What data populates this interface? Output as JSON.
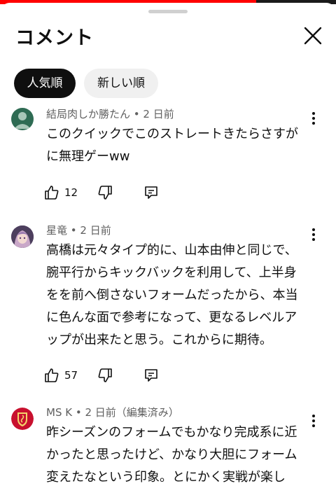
{
  "sheet": {
    "title": "コメント",
    "tabs": [
      {
        "label": "人気順",
        "active": true
      },
      {
        "label": "新しい順",
        "active": false
      }
    ]
  },
  "comments": [
    {
      "author": "結局肉しか勝たん",
      "time": "2 日前",
      "meta": "結局肉しか勝たん • 2 日前",
      "text": "このクイックでこのストレートきたらさすが\nに無理ゲーww",
      "likes": "12"
    },
    {
      "author": "星竜",
      "time": "2 日前",
      "meta": "星竜 • 2 日前",
      "text": "高橋は元々タイプ的に、山本由伸と同じで、\n腕平行からキックバックを利用して、上半身\nをを前へ倒さないフォームだったから、本当\nに色んな面で参考になって、更なるレベルア\nップが出来たと思う。これからに期待。",
      "likes": "57"
    },
    {
      "author": "MS K",
      "time": "2 日前（編集済み）",
      "meta": "MS K • 2 日前（編集済み）",
      "text": "昨シーズンのフォームでもかなり完成系に近\nかったと思ったけど、かなり大胆にフォーム\n変えたなという印象。とにかく実戦が楽し"
    }
  ],
  "icons": {
    "close": "close-icon",
    "like": "thumb-up-icon",
    "dislike": "thumb-down-icon",
    "reply": "reply-icon",
    "more": "more-vert-icon"
  },
  "colors": {
    "active_chip": "#0f0f0f",
    "inactive_chip": "#f0f0f0",
    "meta_text": "#606060",
    "progress": "#ff0000"
  }
}
